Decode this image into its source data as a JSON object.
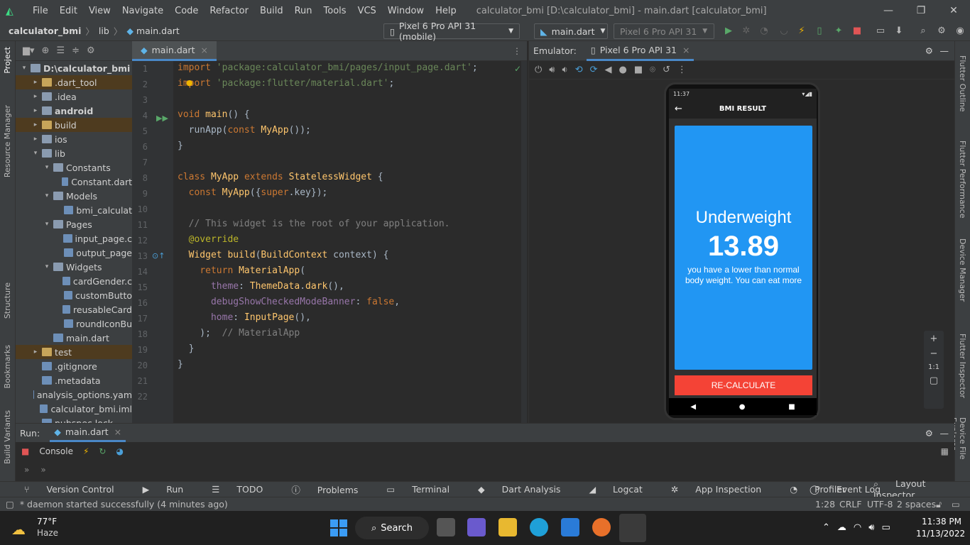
{
  "window": {
    "menu": [
      "File",
      "Edit",
      "View",
      "Navigate",
      "Code",
      "Refactor",
      "Build",
      "Run",
      "Tools",
      "VCS",
      "Window",
      "Help"
    ],
    "title": "calculator_bmi [D:\\calculator_bmi] - main.dart [calculator_bmi]"
  },
  "breadcrumb": {
    "project": "calculator_bmi",
    "folder": "lib",
    "file": "main.dart"
  },
  "toolbar": {
    "device": "Pixel 6 Pro API 31 (mobile)",
    "config": "main.dart",
    "device2": "Pixel 6 Pro API 31"
  },
  "left_strip": [
    "Project",
    "Resource Manager",
    "Structure",
    "Bookmarks",
    "Build Variants"
  ],
  "right_strip": [
    "Flutter Outline",
    "Flutter Performance",
    "Device Manager",
    "Flutter Inspector",
    "Device File Explorer"
  ],
  "tree": [
    {
      "label": "D:\\calculator_bmi",
      "level": 0,
      "open": true,
      "bold": true
    },
    {
      "label": ".dart_tool",
      "level": 1,
      "closed": true,
      "highlight": true
    },
    {
      "label": ".idea",
      "level": 1,
      "closed": true
    },
    {
      "label": "android",
      "level": 1,
      "closed": true,
      "bold": true
    },
    {
      "label": "build",
      "level": 1,
      "closed": true,
      "highlight": true
    },
    {
      "label": "ios",
      "level": 1,
      "closed": true
    },
    {
      "label": "lib",
      "level": 1,
      "open": true
    },
    {
      "label": "Constants",
      "level": 2,
      "open": true
    },
    {
      "label": "Constant.dart",
      "level": 3,
      "file": true
    },
    {
      "label": "Models",
      "level": 2,
      "open": true
    },
    {
      "label": "bmi_calculat",
      "level": 3,
      "file": true
    },
    {
      "label": "Pages",
      "level": 2,
      "open": true
    },
    {
      "label": "input_page.c",
      "level": 3,
      "file": true
    },
    {
      "label": "output_page",
      "level": 3,
      "file": true
    },
    {
      "label": "Widgets",
      "level": 2,
      "open": true
    },
    {
      "label": "cardGender.c",
      "level": 3,
      "file": true
    },
    {
      "label": "customButto",
      "level": 3,
      "file": true
    },
    {
      "label": "reusableCard",
      "level": 3,
      "file": true
    },
    {
      "label": "roundIconBu",
      "level": 3,
      "file": true
    },
    {
      "label": "main.dart",
      "level": 2,
      "file": true
    },
    {
      "label": "test",
      "level": 1,
      "closed": true,
      "highlight": true
    },
    {
      "label": ".gitignore",
      "level": 1,
      "file": true
    },
    {
      "label": ".metadata",
      "level": 1,
      "file": true
    },
    {
      "label": "analysis_options.yam",
      "level": 1,
      "file": true
    },
    {
      "label": "calculator_bmi.iml",
      "level": 1,
      "file": true
    },
    {
      "label": "pubspec.lock",
      "level": 1,
      "file": true
    }
  ],
  "editor": {
    "tab": "main.dart",
    "lines": [
      "1",
      "2",
      "3",
      "4",
      "5",
      "6",
      "7",
      "8",
      "9",
      "10",
      "11",
      "12",
      "13",
      "14",
      "15",
      "16",
      "17",
      "18",
      "19",
      "20",
      "21",
      "22"
    ]
  },
  "emulator": {
    "label": "Emulator:",
    "tab": "Pixel 6 Pro API 31"
  },
  "app": {
    "status_time": "11:37",
    "appbar_title": "BMI RESULT",
    "result_label": "Underweight",
    "bmi_value": "13.89",
    "message": "you have a lower than normal body weight. You can eat more",
    "button": "RE-CALCULATE"
  },
  "zoom": {
    "ratio": "1:1"
  },
  "run": {
    "label": "Run:",
    "tab": "main.dart",
    "console": "Console"
  },
  "bottom_tabs": [
    "Version Control",
    "Run",
    "TODO",
    "Problems",
    "Terminal",
    "Dart Analysis",
    "Logcat",
    "App Inspection",
    "Profiler"
  ],
  "bottom_right": [
    "Event Log",
    "Layout Inspector"
  ],
  "status": {
    "message": "* daemon started successfully (4 minutes ago)",
    "position": "1:28",
    "eol": "CRLF",
    "encoding": "UTF-8",
    "indent": "2 spaces"
  },
  "taskbar": {
    "weather_temp": "77°F",
    "weather_desc": "Haze",
    "search": "Search",
    "time": "11:38 PM",
    "date": "11/13/2022"
  },
  "colors": {
    "accent": "#2196f3",
    "button": "#f44336",
    "editor_bg": "#2b2b2b"
  }
}
